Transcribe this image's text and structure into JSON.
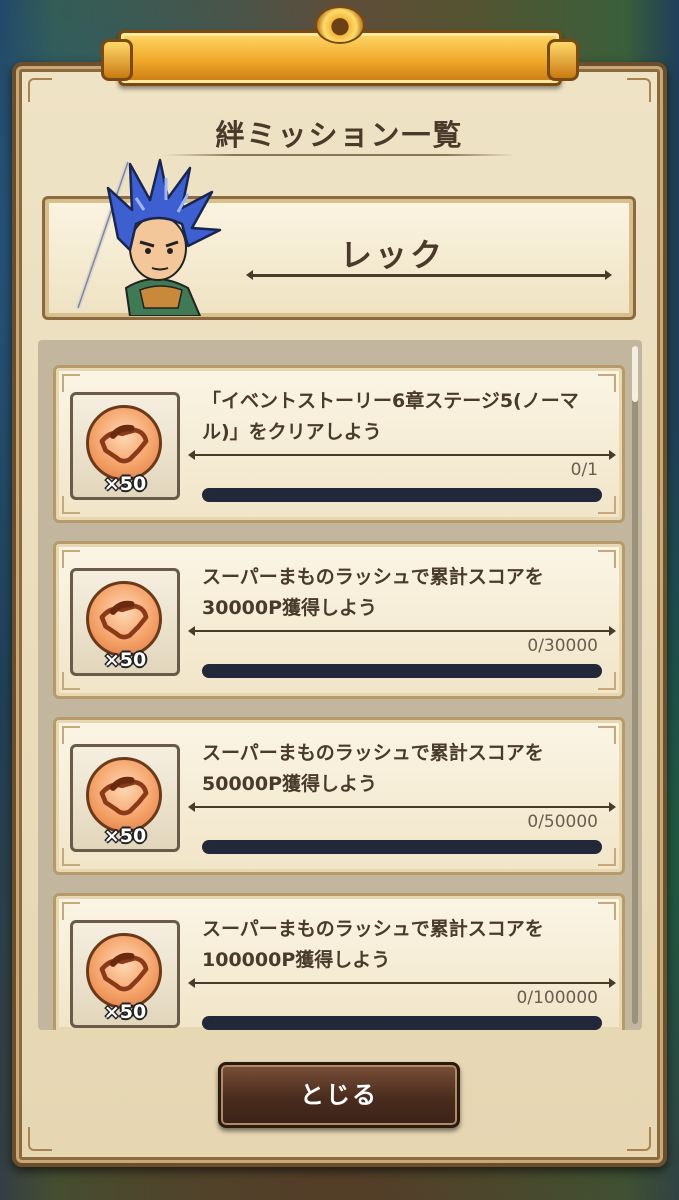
{
  "dialog": {
    "title": "絆ミッション一覧",
    "character_name": "レック",
    "close_label": "とじる"
  },
  "missions": [
    {
      "line1": "「イベントストーリー6章ステージ5(ノーマ",
      "line2": "ル)」をクリアしよう",
      "progress_text": "0/1",
      "progress": 0,
      "reward_icon": "handshake-bond-icon",
      "reward_count": "×50"
    },
    {
      "line1": "スーパーまものラッシュで累計スコアを",
      "line2": "30000P獲得しよう",
      "progress_text": "0/30000",
      "progress": 0,
      "reward_icon": "handshake-bond-icon",
      "reward_count": "×50"
    },
    {
      "line1": "スーパーまものラッシュで累計スコアを",
      "line2": "50000P獲得しよう",
      "progress_text": "0/50000",
      "progress": 0,
      "reward_icon": "handshake-bond-icon",
      "reward_count": "×50"
    },
    {
      "line1": "スーパーまものラッシュで累計スコアを",
      "line2": "100000P獲得しよう",
      "progress_text": "0/100000",
      "progress": 0,
      "reward_icon": "handshake-bond-icon",
      "reward_count": "×50"
    }
  ],
  "colors": {
    "frame": "#efe3c6",
    "banner_gold": "#f0a92a",
    "text_dark": "#4a3a2a",
    "bar_track": "#22283a",
    "button": "#4a2c1e"
  }
}
